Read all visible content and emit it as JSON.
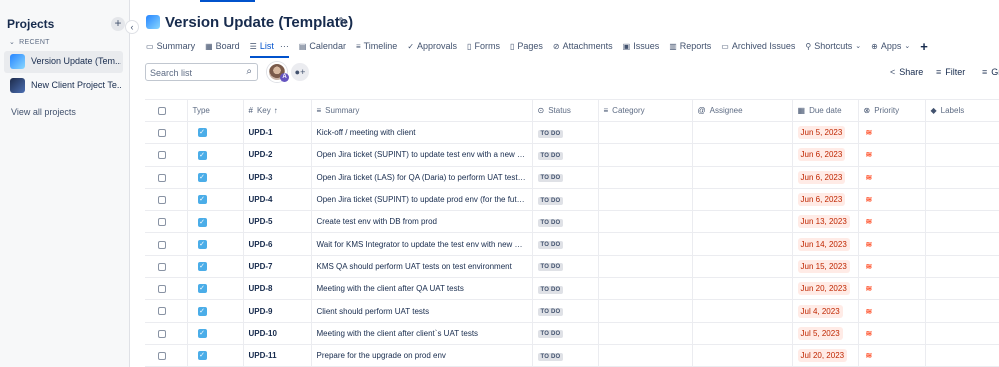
{
  "sidebar": {
    "title": "Projects",
    "add_icon": "plus-icon",
    "recent_label": "RECENT",
    "projects": [
      {
        "name": "Version Update (Tem...",
        "icon": "rocket-project-icon",
        "color": "#4bade8"
      },
      {
        "name": "New Client Project Te...",
        "icon": "rocket-project-icon",
        "color": "#2a3b5c"
      }
    ],
    "view_all": "View all projects"
  },
  "header": {
    "title": "Version Update (Template)",
    "title_icon": "project-icon",
    "pin_icon": "pin-icon"
  },
  "tabs": [
    {
      "label": "Summary",
      "icon": "▭"
    },
    {
      "label": "Board",
      "icon": "▦"
    },
    {
      "label": "List",
      "icon": "☰",
      "active": true
    },
    {
      "label": "Calendar",
      "icon": "▤"
    },
    {
      "label": "Timeline",
      "icon": "≡"
    },
    {
      "label": "Approvals",
      "icon": "✓"
    },
    {
      "label": "Forms",
      "icon": "▯"
    },
    {
      "label": "Pages",
      "icon": "▯"
    },
    {
      "label": "Attachments",
      "icon": "⊘"
    },
    {
      "label": "Issues",
      "icon": "▣"
    },
    {
      "label": "Reports",
      "icon": "▥"
    },
    {
      "label": "Archived Issues",
      "icon": "▭"
    },
    {
      "label": "Shortcuts",
      "icon": "⚲"
    },
    {
      "label": "Apps",
      "icon": "⊕"
    }
  ],
  "toolbar": {
    "search_placeholder": "Search list",
    "share_label": "Share",
    "filter_label": "Filter",
    "group_label": "Gr",
    "avatar_badge": "A"
  },
  "table": {
    "headers": {
      "type": "Type",
      "key": "Key",
      "summary": "Summary",
      "status": "Status",
      "category": "Category",
      "assignee": "Assignee",
      "due": "Due date",
      "priority": "Priority",
      "labels": "Labels"
    },
    "rows": [
      {
        "key": "UPD-1",
        "summary": "Kick-off / meeting with client",
        "status": "TO DO",
        "due": "Jun 5, 2023"
      },
      {
        "key": "UPD-2",
        "summary": "Open Jira ticket (SUPINT) to update test env with a new build",
        "status": "TO DO",
        "due": "Jun 6, 2023"
      },
      {
        "key": "UPD-3",
        "summary": "Open Jira ticket (LAS) for QA (Daria) to perform UAT tests on ...",
        "status": "TO DO",
        "due": "Jun 6, 2023"
      },
      {
        "key": "UPD-4",
        "summary": "Open Jira ticket (SUPINT) to update prod env (for the future)",
        "status": "TO DO",
        "due": "Jun 6, 2023"
      },
      {
        "key": "UPD-5",
        "summary": "Create test env with DB from prod",
        "status": "TO DO",
        "due": "Jun 13, 2023"
      },
      {
        "key": "UPD-6",
        "summary": "Wait for KMS Integrator to update the test env with new build",
        "status": "TO DO",
        "due": "Jun 14, 2023"
      },
      {
        "key": "UPD-7",
        "summary": "KMS QA should perform UAT tests on test environment",
        "status": "TO DO",
        "due": "Jun 15, 2023"
      },
      {
        "key": "UPD-8",
        "summary": "Meeting with the client after QA UAT tests",
        "status": "TO DO",
        "due": "Jun 20, 2023"
      },
      {
        "key": "UPD-9",
        "summary": "Client should perform UAT tests",
        "status": "TO DO",
        "due": "Jul 4, 2023"
      },
      {
        "key": "UPD-10",
        "summary": "Meeting with the client after client`s UAT tests",
        "status": "TO DO",
        "due": "Jul 5, 2023"
      },
      {
        "key": "UPD-11",
        "summary": "Prepare for the upgrade on prod env",
        "status": "TO DO",
        "due": "Jul 20, 2023"
      }
    ]
  }
}
